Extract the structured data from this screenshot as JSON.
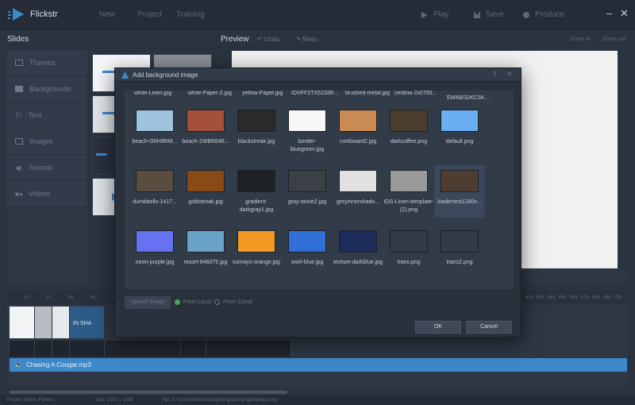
{
  "app": {
    "title": "Flickstr",
    "menu": [
      "New",
      "Project",
      "Training"
    ],
    "actions": {
      "play": "Play",
      "save": "Save",
      "produce": "Produce"
    }
  },
  "subbar": {
    "slides": "Slides",
    "preview": "Preview",
    "undo": "Undo",
    "redo": "Redo",
    "zoom_in": "Zoom in",
    "zoom_out": "Zoom out"
  },
  "nav": [
    {
      "label": "Themes",
      "icon": "themes-icon"
    },
    {
      "label": "Backgrounds",
      "icon": "backgrounds-icon"
    },
    {
      "label": "Text",
      "icon": "text-icon"
    },
    {
      "label": "Images",
      "icon": "images-icon"
    },
    {
      "label": "Sounds",
      "icon": "sounds-icon"
    },
    {
      "label": "Videos",
      "icon": "videos-icon"
    }
  ],
  "timeline": {
    "ruler": [
      "1s",
      "2s",
      "3s",
      "4s",
      "5s"
    ],
    "ruler_right": [
      "62s",
      "63s",
      "64s",
      "65s",
      "66s",
      "67s",
      "68s",
      "69s",
      "70s",
      "71s"
    ],
    "clip_text": "IN SHA",
    "audio": "Chasing A Cougar.mp3"
  },
  "status": {
    "project": "Project Name: Fitness",
    "size": "Size: 1920 x 1080",
    "file": "File: C:\\Users\\test\\Desktop\\templates\\jingemakeja.smp"
  },
  "dialog": {
    "title": "Add background image",
    "help": "?",
    "close": "×",
    "top_cut": [
      "white-Linen.jpg",
      "white-Paper-2.jpg",
      "yellow-Paper.jpg",
      "IDVFF2TX5233R...",
      "brushed-metal.jpg",
      "cestina-2x0760...",
      "EMN8/32KC5K..."
    ],
    "tiles": [
      {
        "label": "beach-00IH9RM...",
        "bg": "#9fc4dd"
      },
      {
        "label": "beach-1WBR646...",
        "bg": "#a4503a"
      },
      {
        "label": "blackstreak.jpg",
        "bg": "#2a2a2c"
      },
      {
        "label": "border-bluegreen.jpg",
        "bg": "#f7f7f7"
      },
      {
        "label": "corkboard2.jpg",
        "bg": "#c98a54"
      },
      {
        "label": "darkcoffee.png",
        "bg": "#4b3c30"
      },
      {
        "label": "default.png",
        "bg": "#6aaef2"
      },
      {
        "label": "dumbbells-1417...",
        "bg": "#5a4c3e"
      },
      {
        "label": "goldstreak.jpg",
        "bg": "#8a4a18"
      },
      {
        "label": "gradient-darkgray1.jpg",
        "bg": "#1e2226"
      },
      {
        "label": "gray-stone2.jpg",
        "bg": "#3b4046"
      },
      {
        "label": "greyinnershado...",
        "bg": "#e2e2e2"
      },
      {
        "label": "iOS-Linen-template-(2).png",
        "bg": "#9a9a9a"
      },
      {
        "label": "loadertest1280x...",
        "bg": "#4d3e31"
      },
      {
        "label": "neon-purple.jpg",
        "bg": "#6672f0"
      },
      {
        "label": "resort-846075.jpg",
        "bg": "#6aa3c8"
      },
      {
        "label": "sunrays-orange.jpg",
        "bg": "#f29a24"
      },
      {
        "label": "swirl-blue.jpg",
        "bg": "#2f6fd6"
      },
      {
        "label": "texture-darkblue.jpg",
        "bg": "#1d2b5a"
      },
      {
        "label": "trans.png",
        "bg": "#323b48"
      },
      {
        "label": "trans2.png",
        "bg": "#323b48"
      }
    ],
    "upload": "Upload Image",
    "from_local": "From Local",
    "from_cloud": "From Cloud",
    "ok": "OK",
    "cancel": "Cancel"
  },
  "colors": {
    "accent_blue": "#3d88c9",
    "radio_selected": "#4aa35b",
    "background": "#2b3340"
  }
}
